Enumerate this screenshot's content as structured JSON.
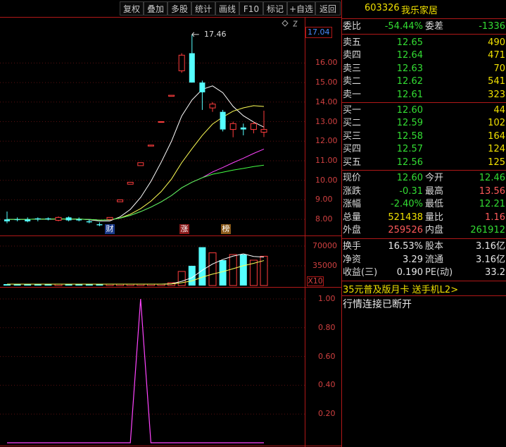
{
  "toolbar": {
    "buttons": [
      "复权",
      "叠加",
      "多股",
      "统计",
      "画线",
      "F10",
      "标记",
      "+自选",
      "返回"
    ]
  },
  "chart": {
    "high_label": "17.46",
    "current_price_tag": "17.04",
    "price_ticks": [
      "16.00",
      "15.00",
      "14.00",
      "13.00",
      "12.00",
      "11.00",
      "10.00",
      "9.00",
      "8.00"
    ],
    "markers": [
      "财",
      "涨",
      "榜"
    ],
    "volume_ticks": [
      "70000",
      "35000"
    ],
    "volume_unit": "X10",
    "indicator_ticks": [
      "1.00",
      "0.80",
      "0.60",
      "0.40",
      "0.20"
    ]
  },
  "chart_data": [
    {
      "type": "candlestick",
      "y_range": [
        7.5,
        17.6
      ],
      "candles": [
        {
          "o": 7.9,
          "c": 8.0,
          "h": 8.4,
          "l": 7.8,
          "up": false
        },
        {
          "o": 8.0,
          "c": 8.0,
          "h": 8.1,
          "l": 7.9,
          "up": false
        },
        {
          "o": 7.9,
          "c": 8.0,
          "h": 8.1,
          "l": 7.85,
          "up": false
        },
        {
          "o": 8.0,
          "c": 8.05,
          "h": 8.1,
          "l": 7.9,
          "up": false
        },
        {
          "o": 8.05,
          "c": 8.0,
          "h": 8.1,
          "l": 7.95,
          "up": false
        },
        {
          "o": 7.95,
          "c": 8.1,
          "h": 8.15,
          "l": 7.9,
          "up": true
        },
        {
          "o": 8.1,
          "c": 7.95,
          "h": 8.15,
          "l": 7.9,
          "up": false
        },
        {
          "o": 7.95,
          "c": 8.0,
          "h": 8.1,
          "l": 7.9,
          "up": false
        },
        {
          "o": 7.9,
          "c": 7.85,
          "h": 8.0,
          "l": 7.8,
          "up": false
        },
        {
          "o": 7.75,
          "c": 7.7,
          "h": 7.85,
          "l": 7.65,
          "up": false
        },
        {
          "o": 8.0,
          "c": 8.1,
          "h": 8.1,
          "l": 7.95,
          "up": true
        },
        {
          "o": 8.9,
          "c": 9.0,
          "h": 9.0,
          "l": 8.9,
          "up": true
        },
        {
          "o": 9.8,
          "c": 9.9,
          "h": 9.9,
          "l": 9.8,
          "up": true
        },
        {
          "o": 10.75,
          "c": 10.9,
          "h": 10.9,
          "l": 10.75,
          "up": true
        },
        {
          "o": 11.75,
          "c": 11.8,
          "h": 11.8,
          "l": 11.75,
          "up": true
        },
        {
          "o": 13.0,
          "c": 13.0,
          "h": 13.0,
          "l": 13.0,
          "up": true
        },
        {
          "o": 14.3,
          "c": 14.35,
          "h": 14.35,
          "l": 14.3,
          "up": true
        },
        {
          "o": 15.6,
          "c": 16.4,
          "h": 16.5,
          "l": 15.5,
          "up": true
        },
        {
          "o": 16.5,
          "c": 15.0,
          "h": 17.46,
          "l": 15.0,
          "up": false
        },
        {
          "o": 15.0,
          "c": 14.5,
          "h": 15.1,
          "l": 13.6,
          "up": false
        },
        {
          "o": 13.7,
          "c": 13.9,
          "h": 14.0,
          "l": 13.5,
          "up": true
        },
        {
          "o": 13.5,
          "c": 12.6,
          "h": 13.6,
          "l": 12.5,
          "up": false
        },
        {
          "o": 12.6,
          "c": 12.9,
          "h": 13.0,
          "l": 12.2,
          "up": true
        },
        {
          "o": 12.7,
          "c": 12.6,
          "h": 12.9,
          "l": 12.3,
          "up": false
        },
        {
          "o": 12.6,
          "c": 12.9,
          "h": 13.0,
          "l": 12.4,
          "up": true
        },
        {
          "o": 12.46,
          "c": 12.6,
          "h": 13.56,
          "l": 12.21,
          "up": true
        }
      ]
    },
    {
      "type": "bar",
      "name": "volume",
      "values": [
        2500,
        2500,
        2500,
        2500,
        2500,
        2500,
        2500,
        2500,
        2500,
        2500,
        2500,
        2500,
        2500,
        2500,
        2500,
        2500,
        5000,
        25000,
        35000,
        68000,
        58000,
        45000,
        55000,
        55000,
        45000,
        52000
      ],
      "ylim": [
        0,
        80000
      ]
    },
    {
      "type": "line",
      "name": "indicator",
      "ylim": [
        0,
        1.0
      ],
      "values": [
        0,
        0,
        0,
        0,
        0,
        0,
        0,
        0,
        0,
        0,
        0,
        0,
        0,
        1,
        0,
        0,
        0,
        0,
        0,
        0,
        0,
        0,
        0,
        0,
        0,
        0
      ]
    }
  ],
  "quote": {
    "code": "603326",
    "name": "我乐家居",
    "weibi_label": "委比",
    "weibi": "-54.44%",
    "weicha_label": "委差",
    "weicha": "-1336",
    "asks": [
      {
        "label": "卖五",
        "price": "12.65",
        "vol": "490"
      },
      {
        "label": "卖四",
        "price": "12.64",
        "vol": "471"
      },
      {
        "label": "卖三",
        "price": "12.63",
        "vol": "70"
      },
      {
        "label": "卖二",
        "price": "12.62",
        "vol": "541"
      },
      {
        "label": "卖一",
        "price": "12.61",
        "vol": "323"
      }
    ],
    "bids": [
      {
        "label": "买一",
        "price": "12.60",
        "vol": "44"
      },
      {
        "label": "买二",
        "price": "12.59",
        "vol": "102"
      },
      {
        "label": "买三",
        "price": "12.58",
        "vol": "164"
      },
      {
        "label": "买四",
        "price": "12.57",
        "vol": "124"
      },
      {
        "label": "买五",
        "price": "12.56",
        "vol": "125"
      }
    ],
    "stats": [
      {
        "l1": "现价",
        "v1": "12.60",
        "c1": "green",
        "l2": "今开",
        "v2": "12.46",
        "c2": "green"
      },
      {
        "l1": "涨跌",
        "v1": "-0.31",
        "c1": "green",
        "l2": "最高",
        "v2": "13.56",
        "c2": "red"
      },
      {
        "l1": "涨幅",
        "v1": "-2.40%",
        "c1": "green",
        "l2": "最低",
        "v2": "12.21",
        "c2": "green"
      },
      {
        "l1": "总量",
        "v1": "521438",
        "c1": "yellow",
        "l2": "量比",
        "v2": "1.16",
        "c2": "red"
      },
      {
        "l1": "外盘",
        "v1": "259526",
        "c1": "red",
        "l2": "内盘",
        "v2": "261912",
        "c2": "green"
      }
    ],
    "fin": [
      {
        "l1": "换手",
        "v1": "16.53%",
        "l2": "股本",
        "v2": "3.16亿"
      },
      {
        "l1": "净资",
        "v1": "3.29",
        "l2": "流通",
        "v2": "3.16亿"
      },
      {
        "l1": "收益(三)",
        "v1": "0.190",
        "l2": "PE(动)",
        "v2": "33.2"
      }
    ],
    "ad": "35元普及版月卡 送手机L2>",
    "status": "行情连接已断开"
  }
}
